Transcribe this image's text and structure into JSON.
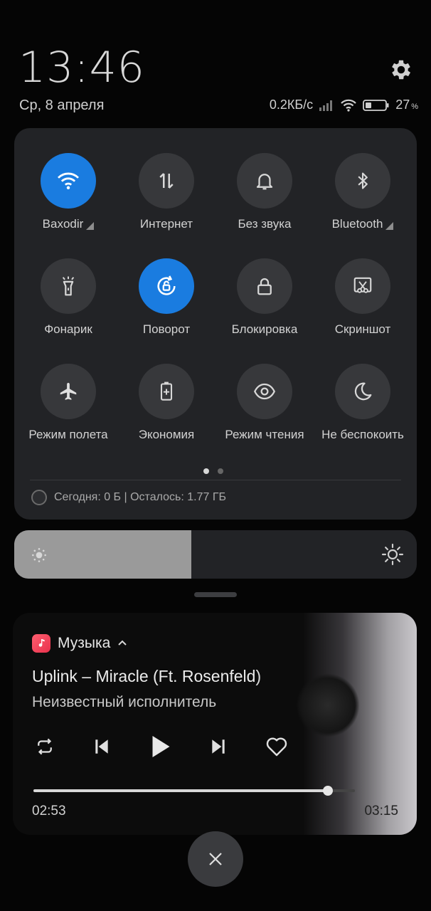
{
  "status": {
    "time": "13:46",
    "date": "Ср, 8 апреля",
    "network_speed": "0.2КБ/с",
    "battery": "27"
  },
  "tiles": [
    {
      "label": "Baxodir",
      "icon": "wifi-icon",
      "active": true,
      "has_more": true
    },
    {
      "label": "Интернет",
      "icon": "mobile-data-icon",
      "active": false,
      "has_more": false
    },
    {
      "label": "Без звука",
      "icon": "bell-icon",
      "active": false,
      "has_more": false
    },
    {
      "label": "Bluetooth",
      "icon": "bluetooth-icon",
      "active": false,
      "has_more": true
    },
    {
      "label": "Фонарик",
      "icon": "flashlight-icon",
      "active": false,
      "has_more": false
    },
    {
      "label": "Поворот",
      "icon": "rotation-lock-icon",
      "active": true,
      "has_more": false
    },
    {
      "label": "Блокировка",
      "icon": "lock-icon",
      "active": false,
      "has_more": false
    },
    {
      "label": "Скриншот",
      "icon": "screenshot-icon",
      "active": false,
      "has_more": false
    },
    {
      "label": "Режим полета",
      "icon": "airplane-icon",
      "active": false,
      "has_more": false
    },
    {
      "label": "Экономия",
      "icon": "battery-saver-icon",
      "active": false,
      "has_more": false
    },
    {
      "label": "Режим чтения",
      "icon": "eye-icon",
      "active": false,
      "has_more": false
    },
    {
      "label": "Не беспокоить",
      "icon": "moon-icon",
      "active": false,
      "has_more": false
    }
  ],
  "data_usage": "Сегодня: 0 Б | Осталось: 1.77 ГБ",
  "brightness_level": 0.44,
  "music": {
    "app_name": "Музыка",
    "title": "Uplink – Miracle (Ft. Rosenfeld)",
    "artist": "Неизвестный исполнитель",
    "elapsed": "02:53",
    "total": "03:15",
    "progress": 0.915
  },
  "colors": {
    "accent": "#1a7ce0",
    "panel": "#222326",
    "music_app_icon": "#e8314c"
  }
}
